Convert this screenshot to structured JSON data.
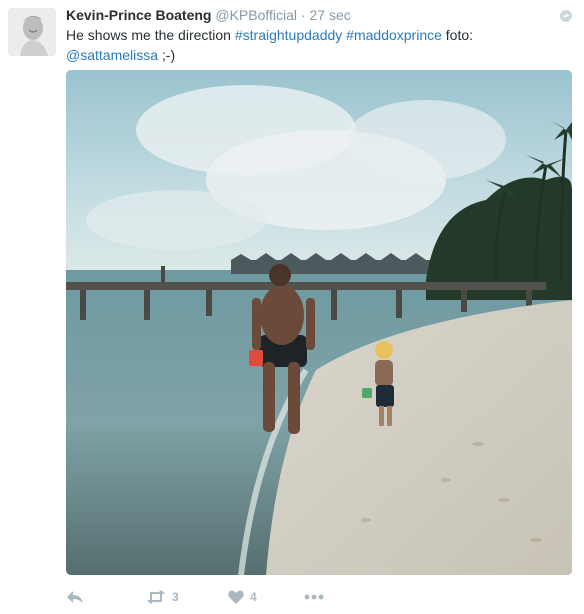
{
  "tweet": {
    "author_name": "Kevin-Prince Boateng",
    "handle": "@KPBofficial",
    "separator": "·",
    "time": "27 sec",
    "text_plain": "He shows me the direction",
    "hashtag_1": "#straightupdaddy",
    "hashtag_2": "#maddoxprince",
    "text_foto": "foto:",
    "mention": "@sattamelissa",
    "text_end": ";-)"
  },
  "actions": {
    "reply_icon": "reply-icon",
    "retweet_icon": "retweet-icon",
    "retweet_count": "3",
    "like_icon": "heart-icon",
    "like_count": "4",
    "more_icon": "more-icon"
  },
  "colors": {
    "link": "#2b7bb9",
    "meta": "#8899a6",
    "action": "#aab8c2",
    "text": "#292f33"
  }
}
